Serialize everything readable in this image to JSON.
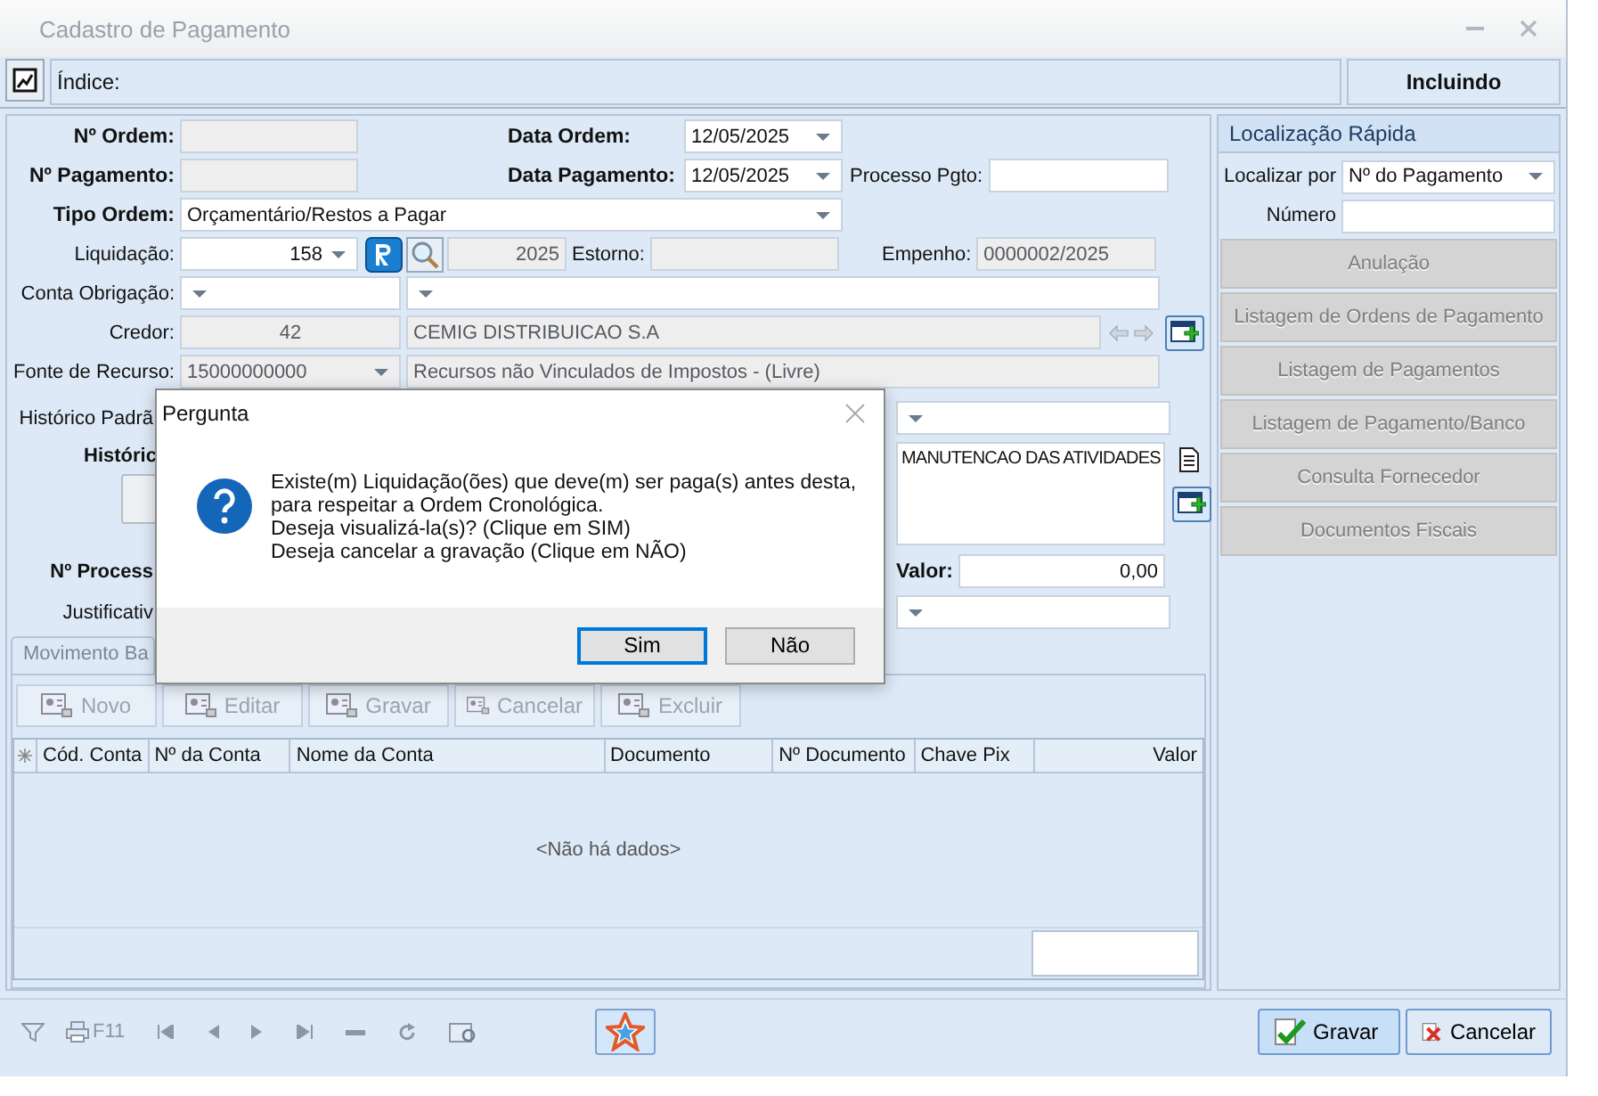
{
  "window": {
    "title": "Cadastro de Pagamento"
  },
  "index_bar": {
    "label": "Índice:",
    "status": "Incluindo"
  },
  "form": {
    "n_ordem": {
      "label": "Nº Ordem:",
      "disabled": true
    },
    "data_ordem": {
      "label": "Data Ordem:",
      "value": "12/05/2025"
    },
    "n_pagamento": {
      "label": "Nº Pagamento:",
      "disabled": true
    },
    "data_pagamento": {
      "label": "Data Pagamento:",
      "value": "12/05/2025"
    },
    "processo_pgto": {
      "label": "Processo Pgto:"
    },
    "tipo_ordem": {
      "label": "Tipo Ordem:",
      "value": "Orçamentário/Restos a Pagar"
    },
    "liquidacao": {
      "label": "Liquidação:",
      "value": "158",
      "year": "2025"
    },
    "estorno": {
      "label": "Estorno:",
      "disabled": true
    },
    "empenho": {
      "label": "Empenho:",
      "value": "0000002/2025",
      "disabled": true
    },
    "conta_obrigacao": {
      "label": "Conta Obrigação:"
    },
    "credor": {
      "label": "Credor:",
      "code": "42",
      "name": "CEMIG DISTRIBUICAO S.A",
      "disabled": true
    },
    "fonte_recurso": {
      "label": "Fonte de Recurso:",
      "code": "15000000000",
      "name": "Recursos não Vinculados de Impostos - (Livre)",
      "disabled": true
    },
    "historico_padrao": {
      "label": "Histórico Padrã"
    },
    "historico": {
      "label": "Históric",
      "value": "MANUTENCAO DAS ATIVIDADES"
    },
    "n_processo": {
      "label": "Nº Process"
    },
    "valor": {
      "label": "Valor:",
      "value": "0,00"
    },
    "justificativa": {
      "label": "Justificativ"
    }
  },
  "tabs": [
    {
      "label": "Movimento Ba",
      "selected": true
    }
  ],
  "grid_toolbar": [
    {
      "label": "Novo",
      "disabled": true
    },
    {
      "label": "Editar",
      "disabled": true
    },
    {
      "label": "Gravar",
      "disabled": true
    },
    {
      "label": "Cancelar",
      "disabled": true
    },
    {
      "label": "Excluir",
      "disabled": true
    }
  ],
  "grid": {
    "columns": [
      "Cód. Conta",
      "Nº da Conta",
      "Nome da Conta",
      "Documento",
      "Nº Documento",
      "Chave Pix",
      "Valor"
    ],
    "empty_text": "<Não há dados>"
  },
  "bottom_toolbar": {
    "print_key": "F11",
    "buttons": [
      {
        "label": "Gravar",
        "kind": "save"
      },
      {
        "label": "Cancelar",
        "kind": "cancel"
      }
    ]
  },
  "quick_search": {
    "title": "Localização Rápida",
    "search_by_label": "Localizar por",
    "search_by_value": "Nº do Pagamento",
    "number_label": "Número",
    "buttons": [
      {
        "label": "Anulação",
        "disabled": true
      },
      {
        "label": "Listagem de Ordens de Pagamento",
        "disabled": true
      },
      {
        "label": "Listagem de Pagamentos",
        "disabled": true
      },
      {
        "label": "Listagem de Pagamento/Banco",
        "disabled": true
      },
      {
        "label": "Consulta Fornecedor",
        "disabled": true
      },
      {
        "label": "Documentos Fiscais",
        "disabled": true
      }
    ]
  },
  "dialog": {
    "title": "Pergunta",
    "message": [
      "Existe(m) Liquidação(ões) que deve(m) ser paga(s) antes desta,",
      "para respeitar a Ordem Cronológica.",
      "Deseja visualizá-la(s)? (Clique em SIM)",
      "Deseja cancelar a gravação (Clique em NÃO)"
    ],
    "buttons": [
      {
        "label": "Sim",
        "selected": true
      },
      {
        "label": "Não",
        "selected": false
      }
    ]
  }
}
